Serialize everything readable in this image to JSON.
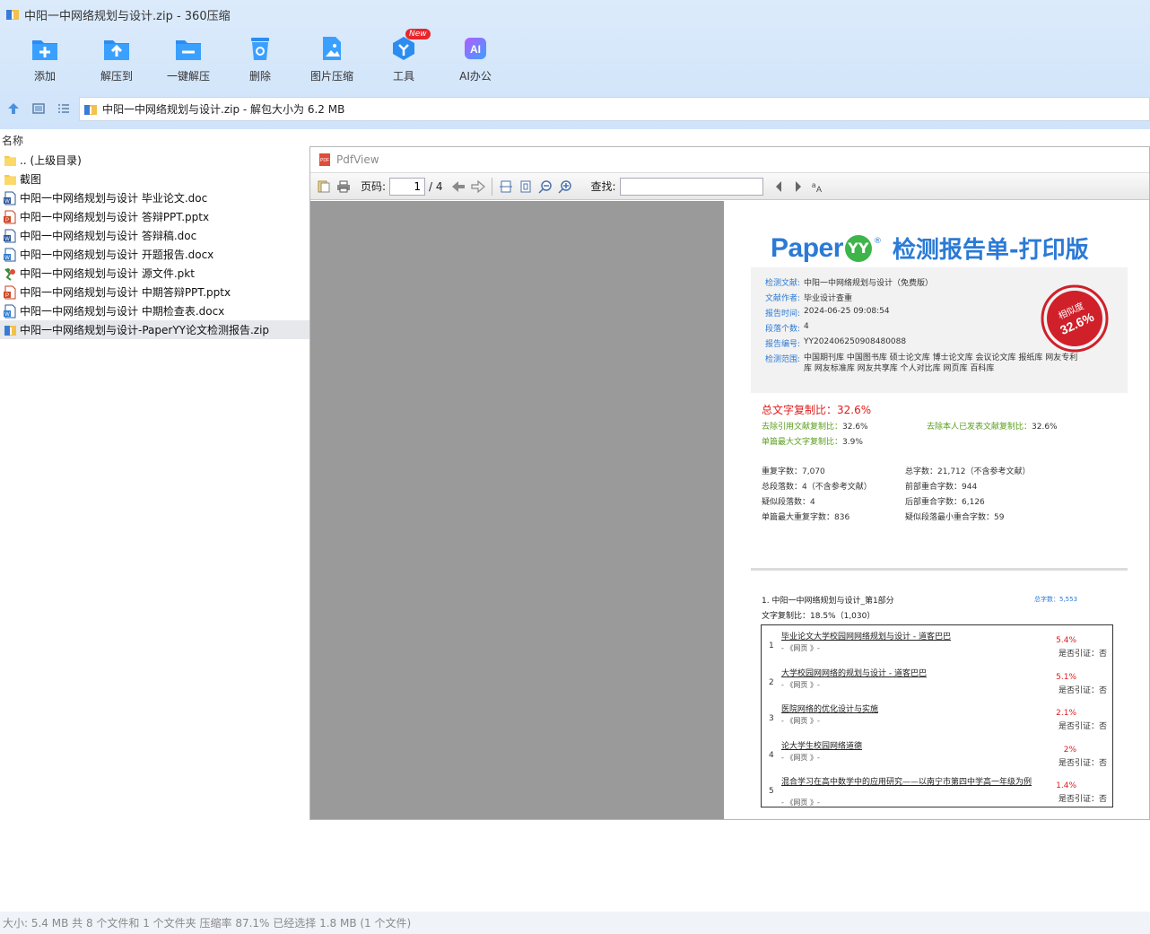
{
  "window": {
    "title": "中阳一中网络规划与设计.zip - 360压缩"
  },
  "toolbar": [
    {
      "label": "添加",
      "icon": "add-icon"
    },
    {
      "label": "解压到",
      "icon": "extract-to-icon"
    },
    {
      "label": "一键解压",
      "icon": "one-click-extract-icon"
    },
    {
      "label": "删除",
      "icon": "delete-icon"
    },
    {
      "label": "图片压缩",
      "icon": "image-compress-icon"
    },
    {
      "label": "工具",
      "icon": "tools-icon",
      "badge": "New"
    },
    {
      "label": "AI办公",
      "icon": "ai-office-icon"
    }
  ],
  "address": {
    "text": "中阳一中网络规划与设计.zip - 解包大小为 6.2 MB"
  },
  "list": {
    "header": "名称",
    "items": [
      {
        "name": ".. (上级目录)",
        "type": "folder"
      },
      {
        "name": "截图",
        "type": "folder"
      },
      {
        "name": "中阳一中网络规划与设计 毕业论文.doc",
        "type": "doc"
      },
      {
        "name": "中阳一中网络规划与设计 答辩PPT.pptx",
        "type": "ppt"
      },
      {
        "name": "中阳一中网络规划与设计 答辩稿.doc",
        "type": "doc"
      },
      {
        "name": "中阳一中网络规划与设计 开题报告.docx",
        "type": "docx"
      },
      {
        "name": "中阳一中网络规划与设计 源文件.pkt",
        "type": "pkt"
      },
      {
        "name": "中阳一中网络规划与设计 中期答辩PPT.pptx",
        "type": "ppt"
      },
      {
        "name": "中阳一中网络规划与设计 中期检查表.docx",
        "type": "docx"
      },
      {
        "name": "中阳一中网络规划与设计-PaperYY论文检测报告.zip",
        "type": "zip",
        "selected": true
      }
    ]
  },
  "pdfview": {
    "title": "PdfView",
    "page_label": "页码:",
    "page_current": "1",
    "page_total": "/ 4",
    "find_label": "查找:",
    "find_value": ""
  },
  "report": {
    "logo_text": "Paper",
    "logo_yy": "YY",
    "logo_reg": "®",
    "title": "检测报告单-打印版",
    "info": [
      {
        "k": "检测文献:",
        "v": "中阳一中网络规划与设计（免费版）"
      },
      {
        "k": "文献作者:",
        "v": "毕业设计查重"
      },
      {
        "k": "报告时间:",
        "v": "2024-06-25 09:08:54"
      },
      {
        "k": "段落个数:",
        "v": "4"
      },
      {
        "k": "报告编号:",
        "v": "YY202406250908480088"
      },
      {
        "k": "检测范围:",
        "v": "中国期刊库 中国图书库 硕士论文库 博士论文库 会议论文库 报纸库 网友专利库 网友标准库 网友共享库 个人对比库 网页库 百科库"
      }
    ],
    "stamp_text": "相似度",
    "stamp_value": "32.6%",
    "total_sim": "总文字复制比：32.6%",
    "sim1_k": "去除引用文献复制比：",
    "sim1_v": "32.6%",
    "sim2_k": "去除本人已发表文献复制比：",
    "sim2_v": "32.6%",
    "sim3_k": "单篇最大文字复制比：",
    "sim3_v": "3.9%",
    "stats": [
      "重复字数：7,070",
      "总字数：21,712（不含参考文献）",
      "总段落数：4（不含参考文献）",
      "前部重合字数：944",
      "疑似段落数：4",
      "后部重合字数：6,126",
      "单篇最大重复字数：836",
      "疑似段落最小重合字数：59"
    ],
    "section_title": "1. 中阳一中网络规划与设计_第1部分",
    "section_count": "总字数：5,553",
    "section_ratio": "文字复制比：18.5%（1,030）",
    "results": [
      {
        "num": "1",
        "title": "毕业论文大学校园网网络规划与设计 - 道客巴巴",
        "src": "- 《网页 》-",
        "pct": "5.4%",
        "cite": "是否引证：否"
      },
      {
        "num": "2",
        "title": "大学校园网网络的规划与设计 - 道客巴巴",
        "src": "- 《网页 》-",
        "pct": "5.1%",
        "cite": "是否引证：否"
      },
      {
        "num": "3",
        "title": "医院网络的优化设计与实施",
        "src": "- 《网页 》-",
        "pct": "2.1%",
        "cite": "是否引证：否"
      },
      {
        "num": "4",
        "title": "论大学生校园网络道德",
        "src": "- 《网页 》-",
        "pct": "2%",
        "cite": "是否引证：否"
      },
      {
        "num": "5",
        "title": "混合学习在高中数学中的应用研究——以南宁市第四中学高一年级为例",
        "src": "- 《网页 》-",
        "pct": "1.4%",
        "cite": "是否引证：否"
      }
    ]
  },
  "status": {
    "text": "大小: 5.4 MB 共 8 个文件和 1 个文件夹 压缩率 87.1% 已经选择 1.8 MB (1 个文件)"
  }
}
